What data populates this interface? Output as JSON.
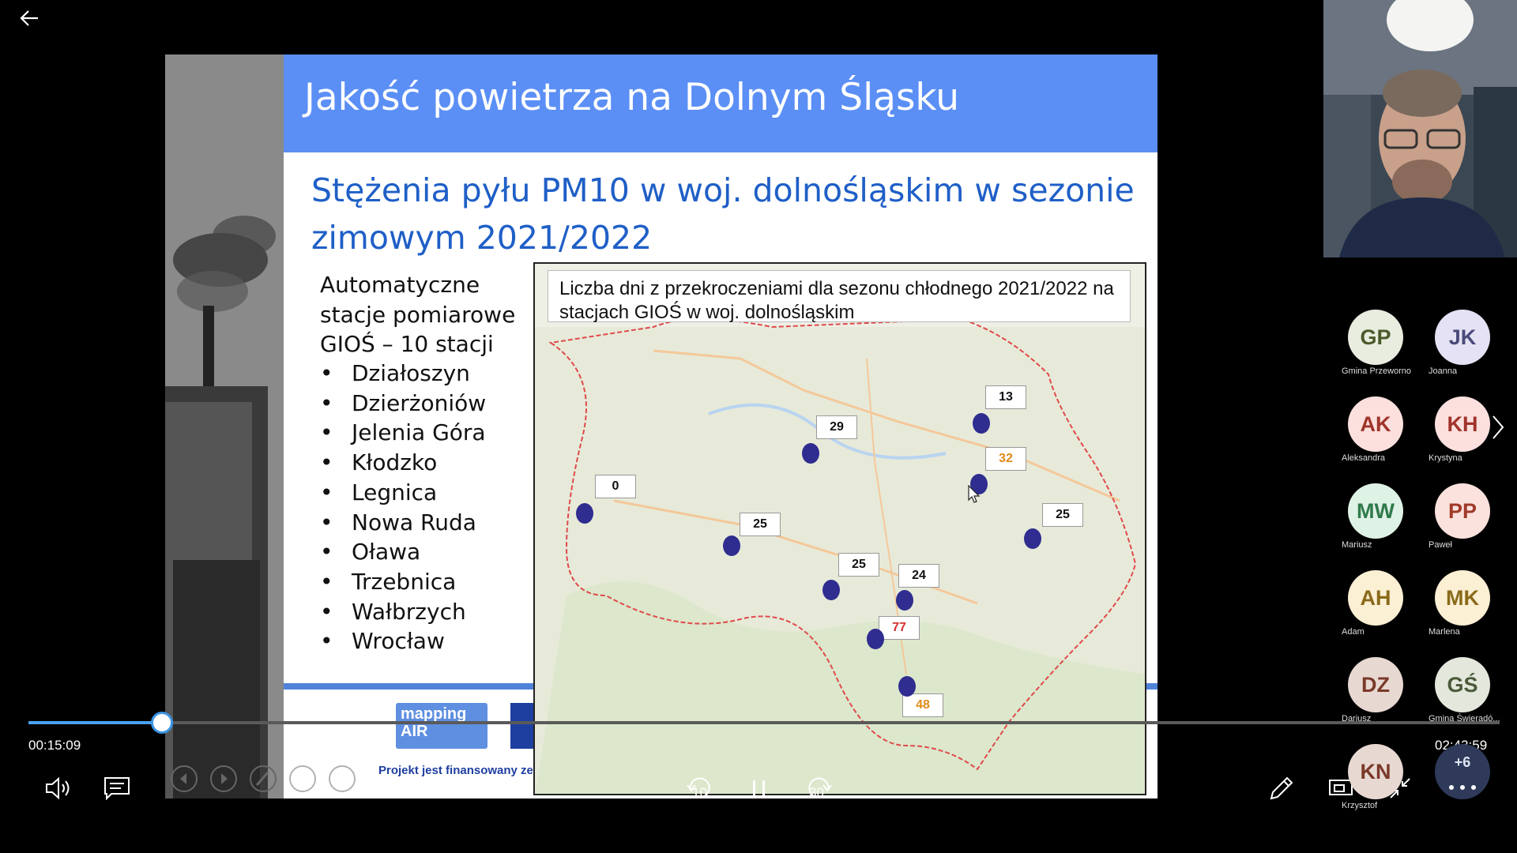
{
  "slide": {
    "title": "Jakość powietrza na Dolnym Śląsku",
    "subtitle": "Stężenia pyłu PM10 w woj. dolnośląskim w sezonie zimowym 2021/2022",
    "stations_intro": "Automatyczne stacje pomiarowe GIOŚ – 10 stacji",
    "stations": [
      "Działoszyn",
      "Dzierżoniów",
      "Jelenia Góra",
      "Kłodzko",
      "Legnica",
      "Nowa Ruda",
      "Oława",
      "Trzebnica",
      "Wałbrzych",
      "Wrocław"
    ],
    "bullet": "•",
    "logo_text": "mapping AIR",
    "footer_text": "Projekt jest finansowany ze",
    "map": {
      "caption": "Liczba dni z przekroczeniami dla sezonu chłodnego 2021/2022 na stacjach GIOŚ w woj. dolnośląskim",
      "stations": [
        {
          "value": "0",
          "color": "#111111"
        },
        {
          "value": "29",
          "color": "#111111"
        },
        {
          "value": "13",
          "color": "#111111"
        },
        {
          "value": "32",
          "color": "#e08a1a"
        },
        {
          "value": "25",
          "color": "#111111"
        },
        {
          "value": "25",
          "color": "#111111"
        },
        {
          "value": "25",
          "color": "#111111"
        },
        {
          "value": "24",
          "color": "#111111"
        },
        {
          "value": "77",
          "color": "#d32f2f"
        },
        {
          "value": "48",
          "color": "#e08a1a"
        }
      ]
    }
  },
  "player": {
    "current_time": "00:15:09",
    "total_time": "02:43:59",
    "progress_fraction": 0.091,
    "skip_back": "10",
    "skip_forward": "30",
    "icons": {
      "back": "arrow-left-icon",
      "volume": "speaker-icon",
      "captions": "captions-icon",
      "rewind": "rewind-icon",
      "pause": "pause-icon",
      "forward": "forward-icon",
      "pen": "pen-icon",
      "cast": "cast-icon",
      "collapse": "collapse-icon"
    }
  },
  "participants": [
    {
      "initials": "GP",
      "name": "Gmina Przeworno",
      "bg": "#e8ede0",
      "fg": "#4a5a2a"
    },
    {
      "initials": "JK",
      "name": "Joanna",
      "bg": "#e4e2f4",
      "fg": "#4a4a7a"
    },
    {
      "initials": "AK",
      "name": "Aleksandra",
      "bg": "#fbe0de",
      "fg": "#a0342a"
    },
    {
      "initials": "KH",
      "name": "Krystyna",
      "bg": "#fbe0de",
      "fg": "#a0342a"
    },
    {
      "initials": "MW",
      "name": "Mariusz",
      "bg": "#dff2e6",
      "fg": "#2f7a4a"
    },
    {
      "initials": "PP",
      "name": "Paweł",
      "bg": "#fbe2dc",
      "fg": "#a03a2a"
    },
    {
      "initials": "AH",
      "name": "Adam",
      "bg": "#fbefd4",
      "fg": "#8a6a1a"
    },
    {
      "initials": "MK",
      "name": "Marlena",
      "bg": "#fbefd4",
      "fg": "#8a6a1a"
    },
    {
      "initials": "DZ",
      "name": "Dariusz",
      "bg": "#e8d8d2",
      "fg": "#7a3a2a"
    },
    {
      "initials": "GŚ",
      "name": "Gmina Świeradó...",
      "bg": "#e4e8dc",
      "fg": "#4a5a3a"
    },
    {
      "initials": "KN",
      "name": "Krzysztof",
      "bg": "#e8d8d2",
      "fg": "#7a3a2a"
    }
  ],
  "more_participants": "+6"
}
